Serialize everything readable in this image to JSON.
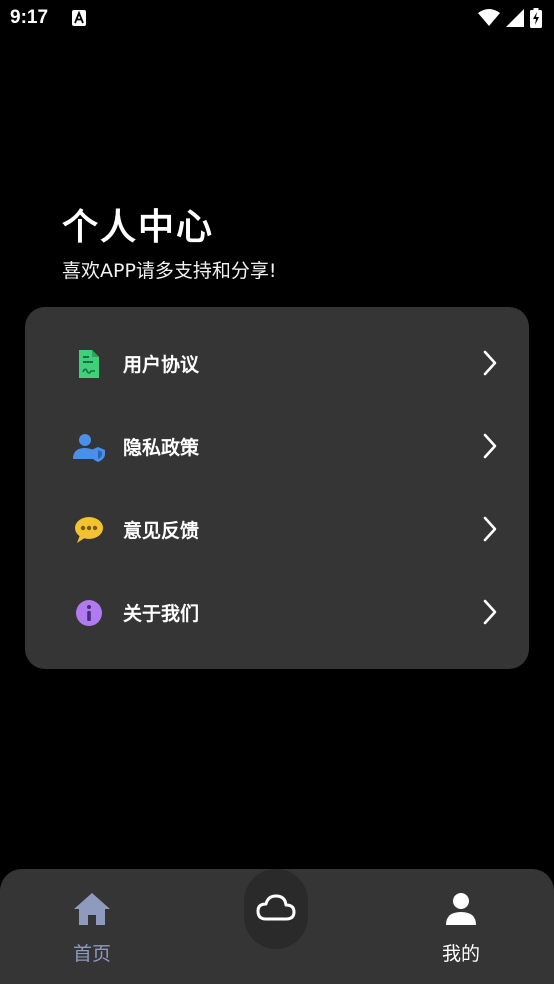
{
  "status_bar": {
    "time": "9:17",
    "icons": [
      "a-notification-icon",
      "wifi-icon",
      "signal-icon",
      "battery-charging-icon"
    ]
  },
  "header": {
    "title": "个人中心",
    "subtitle": "喜欢APP请多支持和分享!"
  },
  "menu": {
    "items": [
      {
        "label": "用户协议",
        "icon": "document-icon",
        "color": "#3fd07a"
      },
      {
        "label": "隐私政策",
        "icon": "user-shield-icon",
        "color": "#4a8fe8"
      },
      {
        "label": "意见反馈",
        "icon": "chat-bubble-icon",
        "color": "#f2c230"
      },
      {
        "label": "关于我们",
        "icon": "info-icon",
        "color": "#b07bef"
      }
    ]
  },
  "bottom_nav": {
    "home_label": "首页",
    "center_icon": "cloud-icon",
    "mine_label": "我的",
    "active": "我的",
    "colors": {
      "inactive": "#8e9bbf",
      "active": "#ffffff"
    }
  },
  "colors": {
    "background": "#000000",
    "card": "#353535",
    "nav_bar": "#353535"
  }
}
